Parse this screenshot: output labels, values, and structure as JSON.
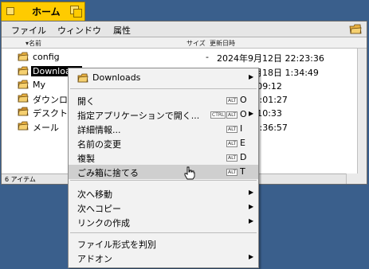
{
  "window": {
    "title": "ホーム",
    "menu": [
      "ファイル",
      "ウィンドウ",
      "属性"
    ],
    "columns": {
      "name": "名前",
      "size": "サイズ",
      "modified": "更新日時"
    },
    "status": "6 アイテム"
  },
  "rows": [
    {
      "name": "config",
      "size": "-",
      "date": "2024年9月12日 22:23:36",
      "icon": "folder-icon"
    },
    {
      "name": "Downloads",
      "size": "",
      "date": "2024年9月18日 1:34:49",
      "icon": "folder-icon",
      "selected": true
    },
    {
      "name": "My",
      "size": "",
      "date": "月18日 0:09:12",
      "icon": "folder-icon"
    },
    {
      "name": "ダウンロ",
      "size": "",
      "date": "月26日 21:01:27",
      "icon": "folder-icon"
    },
    {
      "name": "デスクト",
      "size": "",
      "date": "月18日 9:10:33",
      "icon": "desktop-folder-icon"
    },
    {
      "name": "メール",
      "size": "",
      "date": "月17日 13:36:57",
      "icon": "folder-icon"
    }
  ],
  "context_menu": {
    "header": "Downloads",
    "group1": [
      {
        "label": "開く",
        "mod": "ALT",
        "key": "O"
      },
      {
        "label": "指定アプリケーションで開く...",
        "ctrl": "CTRL",
        "mod": "ALT",
        "key": "O"
      },
      {
        "label": "詳細情報...",
        "mod": "ALT",
        "key": "I"
      },
      {
        "label": "名前の変更",
        "mod": "ALT",
        "key": "E"
      },
      {
        "label": "複製",
        "mod": "ALT",
        "key": "D"
      },
      {
        "label": "ごみ箱に捨てる",
        "mod": "ALT",
        "key": "T"
      }
    ],
    "group2": [
      "次へ移動",
      "次へコピー",
      "リンクの作成"
    ],
    "group3": [
      "ファイル形式を判別",
      "アドオン"
    ]
  },
  "colors": {
    "desktop": "#3a5f8c",
    "tab": "#ffcb00",
    "highlight": "#cfcfcf"
  }
}
